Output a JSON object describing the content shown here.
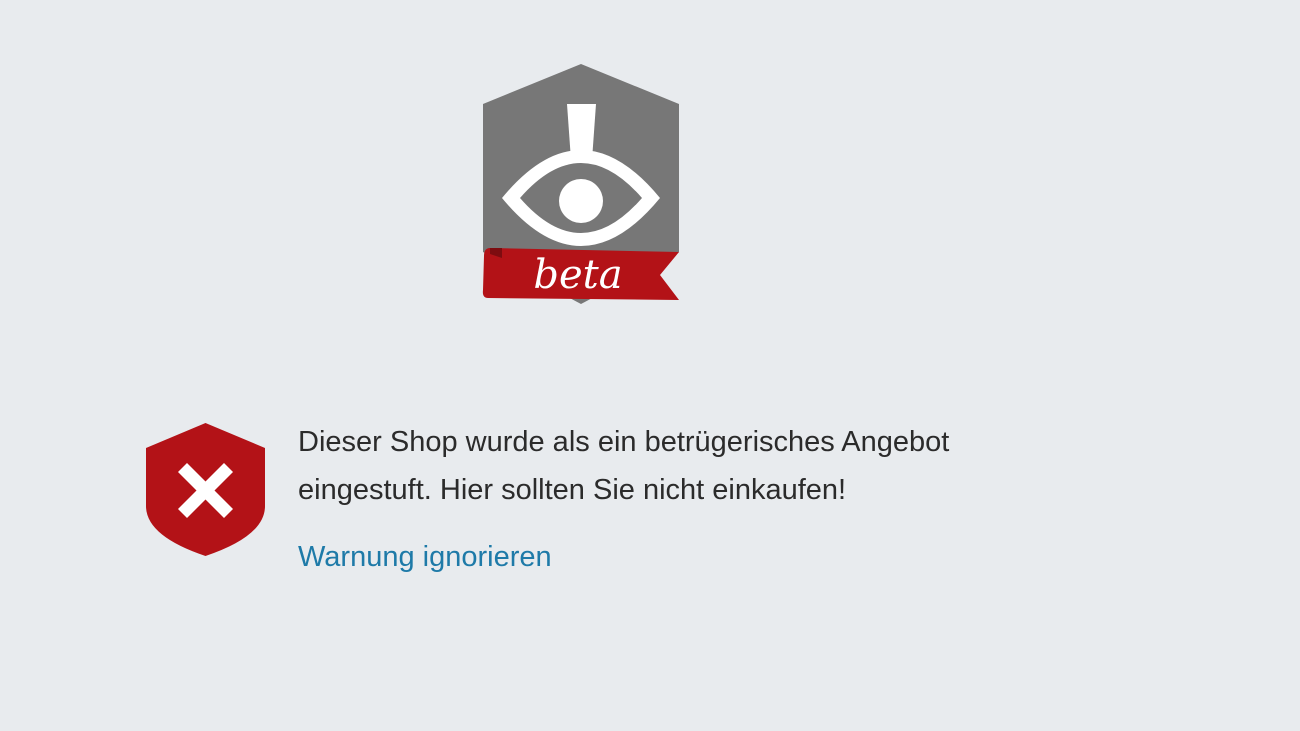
{
  "logo": {
    "badge_text": "beta",
    "icon": "eye-warning-shield-icon",
    "shield_color": "#777777",
    "ribbon_color": "#b31217"
  },
  "warning": {
    "icon": "shield-x-icon",
    "icon_color": "#b31217",
    "message": "Dieser Shop wurde als ein betrügerisches Angebot eingestuft. Hier sollten Sie nicht einkaufen!",
    "ignore_link": "Warnung ignorieren",
    "link_color": "#1e7aa8"
  }
}
